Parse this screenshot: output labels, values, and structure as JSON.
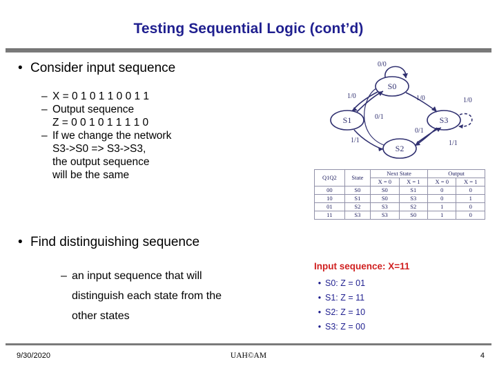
{
  "slide": {
    "title": "Testing Sequential Logic (cont’d)",
    "bullets": [
      {
        "label": "Consider input sequence",
        "subs": [
          {
            "lines": [
              "X = 0 1 0 1 1 0 0 1 1"
            ]
          },
          {
            "lines": [
              "Output sequence",
              "Z = 0 0 1 0 1 1 1 1 0"
            ]
          },
          {
            "lines": [
              "If we change the network",
              "S3->S0 => S3->S3,",
              "the output sequence",
              "will be the same"
            ]
          }
        ]
      },
      {
        "label": "Find distinguishing sequence",
        "subs": [
          {
            "lines": [
              "an input sequence that will",
              "distinguish each state from the",
              "other states"
            ]
          }
        ]
      }
    ],
    "bullet_char": "•",
    "dash_char": "–"
  },
  "fsm": {
    "states": [
      "S0",
      "S1",
      "S3",
      "S2"
    ],
    "edge_labels": [
      "0/0",
      "1/0",
      "0/1",
      "1/0",
      "0/1",
      "1/0",
      "1/1",
      "1/1"
    ]
  },
  "state_table": {
    "group_headers": [
      "Q1Q2",
      "State",
      "Next State",
      "Output"
    ],
    "sub_headers": [
      "X = 0",
      "X = 1",
      "X = 0",
      "X = 1"
    ],
    "rows": [
      {
        "q": "00",
        "state": "S0",
        "n0": "S0",
        "n1": "S1",
        "z0": "0",
        "z1": "0"
      },
      {
        "q": "10",
        "state": "S1",
        "n0": "S0",
        "n1": "S3",
        "z0": "0",
        "z1": "1"
      },
      {
        "q": "01",
        "state": "S2",
        "n0": "S3",
        "n1": "S2",
        "z0": "1",
        "z1": "0"
      },
      {
        "q": "11",
        "state": "S3",
        "n0": "S3",
        "n1": "S0",
        "z0": "1",
        "z1": "0"
      }
    ]
  },
  "input_sequence": {
    "heading": "Input sequence: X=11",
    "items": [
      {
        "bullet": "•",
        "text": "S0: Z = 01"
      },
      {
        "bullet": "•",
        "text": "S1: Z = 11"
      },
      {
        "bullet": "•",
        "text": "S2: Z = 10"
      },
      {
        "bullet": "•",
        "text": "S3: Z = 00"
      }
    ]
  },
  "footer": {
    "date": "9/30/2020",
    "center": "UAH©AM",
    "page": "4"
  }
}
